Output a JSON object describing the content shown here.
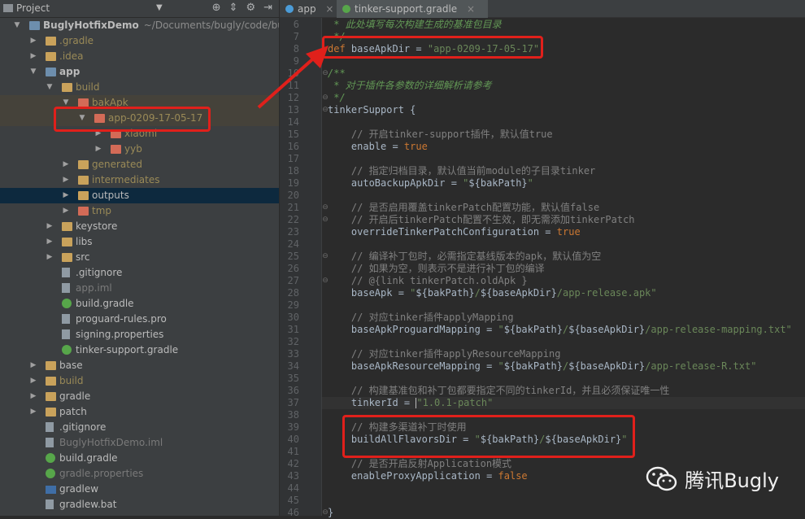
{
  "project_panel": {
    "title": "Project",
    "toolbar_icons": [
      "crosshair-icon",
      "collapse-icon",
      "gear-icon",
      "hide-icon"
    ],
    "tree": [
      {
        "label": "BuglyHotfixDemo",
        "suffix": "~/Documents/bugly/code/bugly-",
        "depth": 0,
        "arrow": "down",
        "icon": "folder-blue",
        "bold": true,
        "row": 0
      },
      {
        "label": ".gradle",
        "depth": 1,
        "arrow": "right",
        "icon": "folder",
        "color": "ign",
        "row": 1
      },
      {
        "label": ".idea",
        "depth": 1,
        "arrow": "right",
        "icon": "folder",
        "color": "ign",
        "row": 2
      },
      {
        "label": "app",
        "depth": 1,
        "arrow": "down",
        "icon": "folder-blue",
        "bold": true,
        "row": 3
      },
      {
        "label": "build",
        "depth": 2,
        "arrow": "down",
        "icon": "folder",
        "color": "ign",
        "row": 4
      },
      {
        "label": "bakApk",
        "depth": 3,
        "arrow": "down",
        "icon": "folder-red",
        "color": "ign",
        "row": 5,
        "highlight": "dim"
      },
      {
        "label": "app-0209-17-05-17",
        "depth": 4,
        "arrow": "down",
        "icon": "folder-red",
        "color": "ign",
        "row": 6,
        "highlight": "dim"
      },
      {
        "label": "xiaomi",
        "depth": 5,
        "arrow": "right",
        "icon": "folder-red",
        "color": "ign",
        "row": 7
      },
      {
        "label": "yyb",
        "depth": 5,
        "arrow": "right",
        "icon": "folder-red",
        "color": "ign",
        "row": 8
      },
      {
        "label": "generated",
        "depth": 3,
        "arrow": "right",
        "icon": "folder",
        "color": "ign",
        "row": 9
      },
      {
        "label": "intermediates",
        "depth": 3,
        "arrow": "right",
        "icon": "folder",
        "color": "ign",
        "row": 10
      },
      {
        "label": "outputs",
        "depth": 3,
        "arrow": "right",
        "icon": "folder",
        "color": "norm",
        "row": 11,
        "highlight": "sel"
      },
      {
        "label": "tmp",
        "depth": 3,
        "arrow": "right",
        "icon": "folder-red",
        "color": "ign",
        "row": 12
      },
      {
        "label": "keystore",
        "depth": 2,
        "arrow": "right",
        "icon": "folder",
        "row": 13
      },
      {
        "label": "libs",
        "depth": 2,
        "arrow": "right",
        "icon": "folder",
        "row": 14
      },
      {
        "label": "src",
        "depth": 2,
        "arrow": "right",
        "icon": "folder",
        "row": 15
      },
      {
        "label": ".gitignore",
        "depth": 2,
        "icon": "file",
        "row": 16
      },
      {
        "label": "app.iml",
        "depth": 2,
        "icon": "file",
        "color": "dim",
        "row": 17
      },
      {
        "label": "build.gradle",
        "depth": 2,
        "icon": "gradle",
        "row": 18
      },
      {
        "label": "proguard-rules.pro",
        "depth": 2,
        "icon": "file",
        "row": 19
      },
      {
        "label": "signing.properties",
        "depth": 2,
        "icon": "file",
        "row": 20
      },
      {
        "label": "tinker-support.gradle",
        "depth": 2,
        "icon": "gradle",
        "row": 21
      },
      {
        "label": "base",
        "depth": 1,
        "arrow": "right",
        "icon": "folder",
        "row": 22
      },
      {
        "label": "build",
        "depth": 1,
        "arrow": "right",
        "icon": "folder",
        "color": "ign",
        "row": 23
      },
      {
        "label": "gradle",
        "depth": 1,
        "arrow": "right",
        "icon": "folder",
        "row": 24
      },
      {
        "label": "patch",
        "depth": 1,
        "arrow": "right",
        "icon": "folder",
        "row": 25
      },
      {
        "label": ".gitignore",
        "depth": 1,
        "icon": "file",
        "row": 26
      },
      {
        "label": "BuglyHotfixDemo.iml",
        "depth": 1,
        "icon": "file",
        "color": "dim",
        "row": 27
      },
      {
        "label": "build.gradle",
        "depth": 1,
        "icon": "gradle",
        "row": 28
      },
      {
        "label": "gradle.properties",
        "depth": 1,
        "icon": "gradle",
        "color": "dim",
        "row": 29
      },
      {
        "label": "gradlew",
        "depth": 1,
        "icon": "terminal",
        "row": 30
      },
      {
        "label": "gradlew.bat",
        "depth": 1,
        "icon": "file",
        "row": 31
      }
    ]
  },
  "editor": {
    "tabs": [
      {
        "label": "app",
        "close": "×",
        "active": false
      },
      {
        "label": "tinker-support.gradle",
        "close": "×",
        "active": true
      }
    ],
    "lines": [
      {
        "n": "6",
        "tokens": [
          {
            "t": " * 此处填写每次构建生成的基准包目录",
            "c": "doc"
          }
        ]
      },
      {
        "n": "7",
        "tokens": [
          {
            "t": " */",
            "c": "doc"
          }
        ]
      },
      {
        "n": "8",
        "tokens": [
          {
            "t": "def",
            "c": "kw"
          },
          {
            "t": " baseApkDir = ",
            "c": "id"
          },
          {
            "t": "\"app-0209-17-05-17\"",
            "c": "str"
          }
        ]
      },
      {
        "n": "9",
        "tokens": []
      },
      {
        "n": "10",
        "tokens": [
          {
            "t": "/**",
            "c": "doc"
          }
        ],
        "fold": "⊖"
      },
      {
        "n": "11",
        "tokens": [
          {
            "t": " * 对于插件各参数的详细解析请参考",
            "c": "doc"
          }
        ]
      },
      {
        "n": "12",
        "tokens": [
          {
            "t": " */",
            "c": "doc"
          }
        ],
        "fold": "⊖"
      },
      {
        "n": "13",
        "tokens": [
          {
            "t": "tinkerSupport {",
            "c": "id"
          }
        ],
        "fold": "⊖"
      },
      {
        "n": "14",
        "tokens": []
      },
      {
        "n": "15",
        "tokens": [
          {
            "t": "    // 开启tinker-support插件，默认值true",
            "c": "com"
          }
        ]
      },
      {
        "n": "16",
        "tokens": [
          {
            "t": "    enable = ",
            "c": "id"
          },
          {
            "t": "true",
            "c": "kw"
          }
        ]
      },
      {
        "n": "17",
        "tokens": []
      },
      {
        "n": "18",
        "tokens": [
          {
            "t": "    // 指定归档目录，默认值当前module的子目录tinker",
            "c": "com"
          }
        ]
      },
      {
        "n": "19",
        "tokens": [
          {
            "t": "    autoBackupApkDir = ",
            "c": "id"
          },
          {
            "t": "\"",
            "c": "str"
          },
          {
            "t": "${bakPath}",
            "c": "tmpl"
          },
          {
            "t": "\"",
            "c": "str"
          }
        ]
      },
      {
        "n": "20",
        "tokens": []
      },
      {
        "n": "21",
        "tokens": [
          {
            "t": "    // 是否启用覆盖tinkerPatch配置功能，默认值false",
            "c": "com"
          }
        ],
        "fold": "⊖"
      },
      {
        "n": "22",
        "tokens": [
          {
            "t": "    // 开启后tinkerPatch配置不生效，即无需添加tinkerPatch",
            "c": "com"
          }
        ],
        "fold": "⊖"
      },
      {
        "n": "23",
        "tokens": [
          {
            "t": "    overrideTinkerPatchConfiguration = ",
            "c": "id"
          },
          {
            "t": "true",
            "c": "kw"
          }
        ]
      },
      {
        "n": "24",
        "tokens": []
      },
      {
        "n": "25",
        "tokens": [
          {
            "t": "    // 编译补丁包时，必需指定基线版本的apk，默认值为空",
            "c": "com"
          }
        ],
        "fold": "⊖"
      },
      {
        "n": "26",
        "tokens": [
          {
            "t": "    // 如果为空，则表示不是进行补丁包的编译",
            "c": "com"
          }
        ]
      },
      {
        "n": "27",
        "tokens": [
          {
            "t": "    // @{link tinkerPatch.oldApk }",
            "c": "com"
          }
        ],
        "fold": "⊖"
      },
      {
        "n": "28",
        "tokens": [
          {
            "t": "    baseApk = ",
            "c": "id"
          },
          {
            "t": "\"",
            "c": "str"
          },
          {
            "t": "${bakPath}",
            "c": "tmpl"
          },
          {
            "t": "/",
            "c": "str"
          },
          {
            "t": "${baseApkDir}",
            "c": "tmpl"
          },
          {
            "t": "/app-release.apk\"",
            "c": "str"
          }
        ]
      },
      {
        "n": "29",
        "tokens": []
      },
      {
        "n": "30",
        "tokens": [
          {
            "t": "    // 对应tinker插件applyMapping",
            "c": "com"
          }
        ]
      },
      {
        "n": "31",
        "tokens": [
          {
            "t": "    baseApkProguardMapping = ",
            "c": "id"
          },
          {
            "t": "\"",
            "c": "str"
          },
          {
            "t": "${bakPath}",
            "c": "tmpl"
          },
          {
            "t": "/",
            "c": "str"
          },
          {
            "t": "${baseApkDir}",
            "c": "tmpl"
          },
          {
            "t": "/app-release-mapping.txt\"",
            "c": "str"
          }
        ]
      },
      {
        "n": "32",
        "tokens": []
      },
      {
        "n": "33",
        "tokens": [
          {
            "t": "    // 对应tinker插件applyResourceMapping",
            "c": "com"
          }
        ]
      },
      {
        "n": "34",
        "tokens": [
          {
            "t": "    baseApkResourceMapping = ",
            "c": "id"
          },
          {
            "t": "\"",
            "c": "str"
          },
          {
            "t": "${bakPath}",
            "c": "tmpl"
          },
          {
            "t": "/",
            "c": "str"
          },
          {
            "t": "${baseApkDir}",
            "c": "tmpl"
          },
          {
            "t": "/app-release-R.txt\"",
            "c": "str"
          }
        ]
      },
      {
        "n": "35",
        "tokens": []
      },
      {
        "n": "36",
        "tokens": [
          {
            "t": "    // 构建基准包和补丁包都要指定不同的tinkerId，并且必须保证唯一性",
            "c": "com"
          }
        ]
      },
      {
        "n": "37",
        "tokens": [
          {
            "t": "    tinkerId = ",
            "c": "id"
          },
          {
            "t": "\"1.0.1-patch\"",
            "c": "str"
          }
        ],
        "caret": true
      },
      {
        "n": "38",
        "tokens": []
      },
      {
        "n": "39",
        "tokens": [
          {
            "t": "    // 构建多渠道补丁时使用",
            "c": "com"
          }
        ]
      },
      {
        "n": "40",
        "tokens": [
          {
            "t": "    buildAllFlavorsDir = ",
            "c": "id"
          },
          {
            "t": "\"",
            "c": "str"
          },
          {
            "t": "${bakPath}",
            "c": "tmpl"
          },
          {
            "t": "/",
            "c": "str"
          },
          {
            "t": "${baseApkDir}",
            "c": "tmpl"
          },
          {
            "t": "\"",
            "c": "str"
          }
        ]
      },
      {
        "n": "41",
        "tokens": []
      },
      {
        "n": "42",
        "tokens": [
          {
            "t": "    // 是否开启反射Application模式",
            "c": "com"
          }
        ]
      },
      {
        "n": "43",
        "tokens": [
          {
            "t": "    enableProxyApplication = ",
            "c": "id"
          },
          {
            "t": "false",
            "c": "kw"
          }
        ]
      },
      {
        "n": "44",
        "tokens": []
      },
      {
        "n": "45",
        "tokens": []
      },
      {
        "n": "46",
        "tokens": [
          {
            "t": "}",
            "c": "id"
          }
        ],
        "fold": "⊖"
      }
    ]
  },
  "watermark": {
    "text": "腾讯Bugly",
    "icon": "wechat-icon"
  },
  "colors": {
    "highlight_box": "#e0201b",
    "keyword": "#cc7832",
    "string": "#6a8759",
    "comment": "#808080"
  }
}
